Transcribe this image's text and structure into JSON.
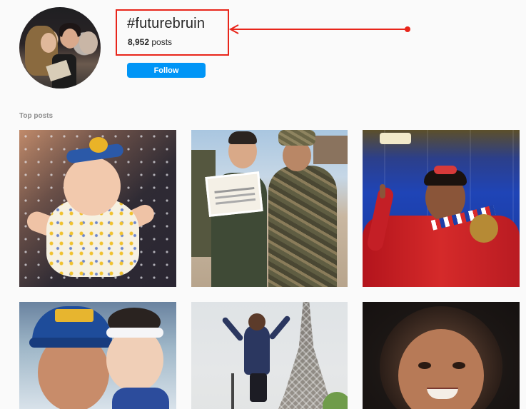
{
  "header": {
    "hashtag": "#futurebruin",
    "post_count": "8,952",
    "post_count_suffix": " posts",
    "follow_label": "Follow"
  },
  "annotation": {
    "highlight_color": "#e8251a"
  },
  "sections": {
    "top_posts_label": "Top posts"
  },
  "posts": [
    {
      "name": "baby-with-bow-on-star-pillow"
    },
    {
      "name": "two-marines-with-certificate"
    },
    {
      "name": "gymnast-with-medal"
    },
    {
      "name": "mom-and-baby-selfie"
    },
    {
      "name": "girl-jumping-eiffel-tower"
    },
    {
      "name": "smiling-curly-hair-girl"
    }
  ],
  "colors": {
    "follow_button": "#0095f6",
    "background": "#fafafa"
  }
}
